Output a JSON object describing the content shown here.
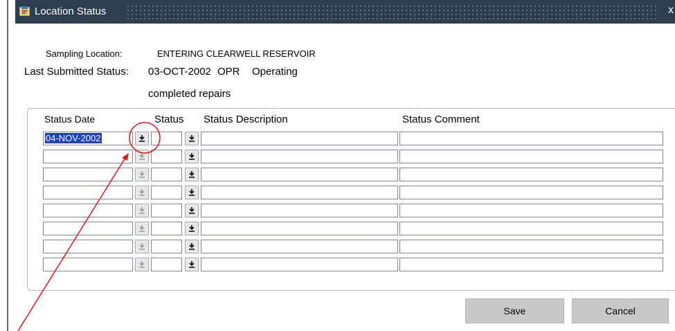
{
  "window": {
    "title": "Location Status",
    "close_glyph": "x",
    "title_icon": "window-form-icon"
  },
  "info": {
    "sampling_location_label": "Sampling Location:",
    "sampling_location_value": "ENTERING CLEARWELL RESERVOIR",
    "last_status_label": "Last Submitted Status:",
    "last_status_date": "03-OCT-2002",
    "last_status_code": "OPR",
    "last_status_desc": "Operating",
    "last_status_comment": "completed repairs"
  },
  "table": {
    "headers": {
      "date": "Status Date",
      "status": "Status",
      "description": "Status Description",
      "comment": "Status Comment"
    },
    "rows": [
      {
        "date": "04-NOV-2002",
        "status": "",
        "description": "",
        "comment": ""
      },
      {
        "date": "",
        "status": "",
        "description": "",
        "comment": ""
      },
      {
        "date": "",
        "status": "",
        "description": "",
        "comment": ""
      },
      {
        "date": "",
        "status": "",
        "description": "",
        "comment": ""
      },
      {
        "date": "",
        "status": "",
        "description": "",
        "comment": ""
      },
      {
        "date": "",
        "status": "",
        "description": "",
        "comment": ""
      },
      {
        "date": "",
        "status": "",
        "description": "",
        "comment": ""
      },
      {
        "date": "",
        "status": "",
        "description": "",
        "comment": ""
      }
    ]
  },
  "buttons": {
    "save": "Save",
    "cancel": "Cancel"
  },
  "annotation": {
    "circle_color": "#e01818",
    "arrow_color": "#e01818"
  }
}
